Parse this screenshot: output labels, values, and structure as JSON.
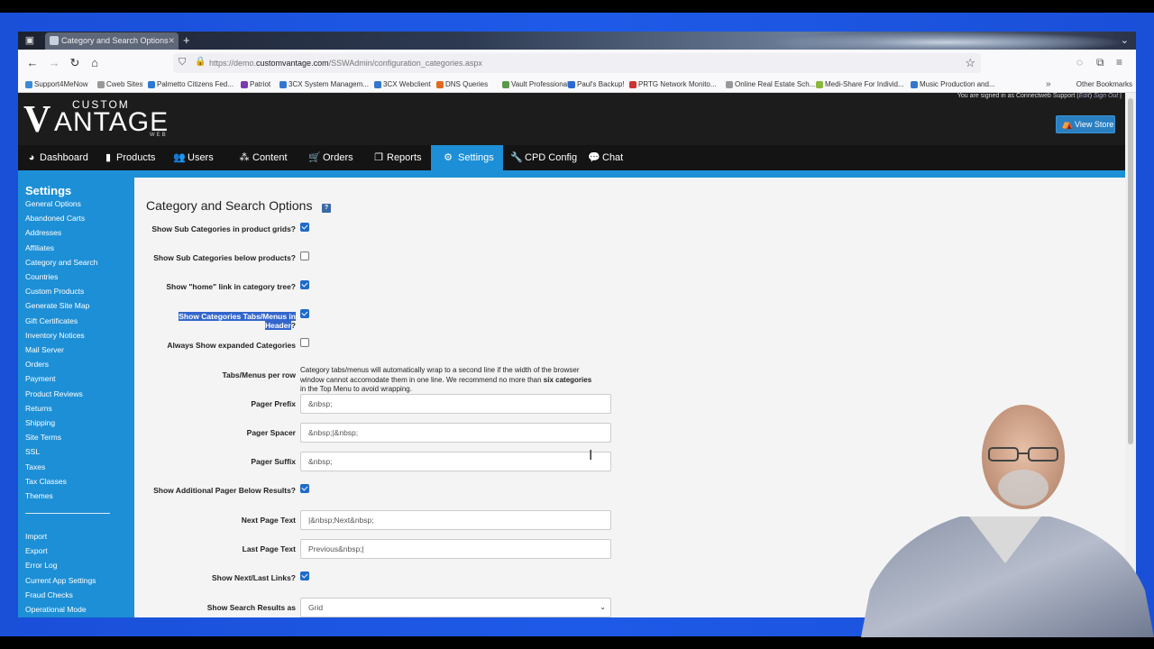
{
  "browser": {
    "tab_title": "Category and Search Options",
    "new_tab": "+",
    "url_host_prefix": "https://demo.",
    "url_host": "customvantage.com",
    "url_path": "/SSWAdmin/configuration_categories.aspx",
    "bookmarks": [
      {
        "label": "Support4MeNow",
        "color": "#3a8ad8"
      },
      {
        "label": "Cweb Sites",
        "color": "#999999"
      },
      {
        "label": "Palmetto Citizens Fed...",
        "color": "#2a7ad0"
      },
      {
        "label": "Patriot",
        "color": "#7a3ab0"
      },
      {
        "label": "3CX System Managem...",
        "color": "#3377cc"
      },
      {
        "label": "3CX Webclient",
        "color": "#3377cc"
      },
      {
        "label": "DNS Queries",
        "color": "#e06a20"
      },
      {
        "label": "Vault Professional",
        "color": "#5a9a4a"
      },
      {
        "label": "Paul's Backup!",
        "color": "#2a6ad0"
      },
      {
        "label": "PRTG Network Monito...",
        "color": "#cc3333"
      },
      {
        "label": "Online Real Estate Sch...",
        "color": "#999999"
      },
      {
        "label": "Medi-Share For Individ...",
        "color": "#8ab83a"
      },
      {
        "label": "Music Production and...",
        "color": "#3377cc"
      }
    ],
    "bookmarks_more": "»",
    "other_bookmarks": "Other Bookmarks"
  },
  "header": {
    "logo_custom": "CUSTOM",
    "logo_v": "V",
    "logo_antage": "ANTAGE",
    "logo_web": "WEB",
    "signed_in_text": "You are signed in as Connectweb Support (",
    "edit_link": "Edit",
    "signed_sep": ") ",
    "signout_link": "Sign Out",
    "signed_end": " |",
    "view_store": "View Store"
  },
  "nav": [
    {
      "label": "Dashboard",
      "icon": "dashboard-icon",
      "glyph": "◕"
    },
    {
      "label": "Products",
      "icon": "products-icon",
      "glyph": "▮"
    },
    {
      "label": "Users",
      "icon": "users-icon",
      "glyph": "👥"
    },
    {
      "label": "Content",
      "icon": "content-icon",
      "glyph": "⁂"
    },
    {
      "label": "Orders",
      "icon": "cart-icon",
      "glyph": "🛒"
    },
    {
      "label": "Reports",
      "icon": "reports-icon",
      "glyph": "❐"
    },
    {
      "label": "Settings",
      "icon": "gear-icon",
      "glyph": "⚙"
    },
    {
      "label": "CPD Config",
      "icon": "wrench-icon",
      "glyph": "🔧"
    },
    {
      "label": "Chat",
      "icon": "chat-icon",
      "glyph": "💬"
    }
  ],
  "sidebar": {
    "title": "Settings",
    "items": [
      "General Options",
      "Abandoned Carts",
      "Addresses",
      "Affiliates",
      "Category and Search",
      "Countries",
      "Custom Products",
      "Generate Site Map",
      "Gift Certificates",
      "Inventory Notices",
      "Mail Server",
      "Orders",
      "Payment",
      "Product Reviews",
      "Returns",
      "Shipping",
      "Site Terms",
      "SSL",
      "Taxes",
      "Tax Classes",
      "Themes"
    ],
    "items2": [
      "Import",
      "Export",
      "Error Log",
      "Current App Settings",
      "Fraud Checks",
      "Operational Mode"
    ]
  },
  "content": {
    "title": "Category and Search Options",
    "help": "?",
    "options": {
      "sub_grids": {
        "label": "Show Sub Categories in product grids?",
        "checked": true
      },
      "sub_below": {
        "label": "Show Sub Categories below products?",
        "checked": false
      },
      "home_link": {
        "label": "Show \"home\" link in category tree?",
        "checked": true
      },
      "tabs_header": {
        "label_line1": "Show Categories Tabs/Menus in",
        "label_line2": "Header",
        "label_q": "?",
        "checked": true
      },
      "expanded": {
        "label": "Always Show expanded Categories",
        "checked": false
      },
      "tabs_per_row": {
        "label": "Tabs/Menus per row",
        "note_line1": "Category tabs/menus will automatically wrap to a second line if the width of the browser",
        "note_line2_a": "window cannot accomodate them in one line. We recommend no more than ",
        "note_line2_b": "six categories",
        "note_line3": "in the Top Menu to avoid wrapping."
      },
      "pager_prefix": {
        "label": "Pager Prefix",
        "value": "&nbsp;"
      },
      "pager_spacer": {
        "label": "Pager Spacer",
        "value": "&nbsp;|&nbsp;"
      },
      "pager_suffix": {
        "label": "Pager Suffix",
        "value": "&nbsp;"
      },
      "additional_pager": {
        "label": "Show Additional Pager Below Results?",
        "checked": true
      },
      "next_page": {
        "label": "Next Page Text",
        "value": "|&nbsp;Next&nbsp;"
      },
      "last_page": {
        "label": "Last Page Text",
        "value": "Previous&nbsp;|"
      },
      "next_last_links": {
        "label": "Show Next/Last Links?",
        "checked": true
      },
      "search_results_as": {
        "label": "Show Search Results as",
        "value": "Grid"
      }
    }
  }
}
